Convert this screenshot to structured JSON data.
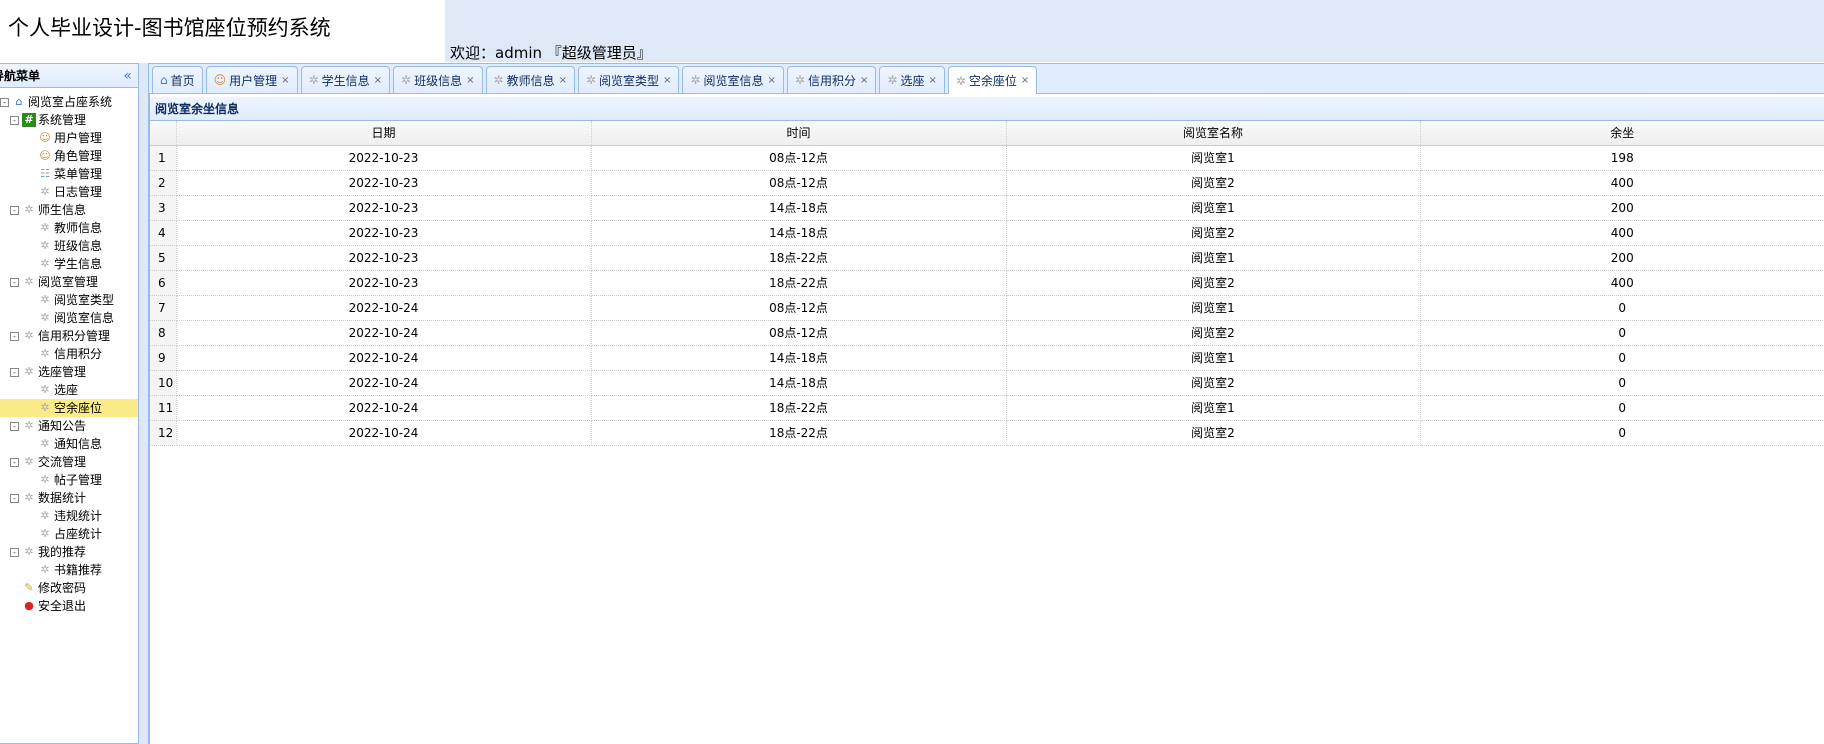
{
  "header": {
    "title": "个人毕业设计-图书馆座位预约系统",
    "welcome": "欢迎：admin 『超级管理员』"
  },
  "sidebar": {
    "title": "导航菜单",
    "collapse": "«",
    "items": [
      {
        "label": "阅览室占座系统",
        "level": 0,
        "icon": "home-icon",
        "toggle": "⊟"
      },
      {
        "label": "系统管理",
        "level": 1,
        "icon": "hash-icon",
        "toggle": "⊟"
      },
      {
        "label": "用户管理",
        "level": 2,
        "icon": "user-icon"
      },
      {
        "label": "角色管理",
        "level": 2,
        "icon": "users-icon"
      },
      {
        "label": "菜单管理",
        "level": 2,
        "icon": "sitemap-icon"
      },
      {
        "label": "日志管理",
        "level": 2,
        "icon": "gear-icon"
      },
      {
        "label": "师生信息",
        "level": 1,
        "icon": "gear-icon",
        "toggle": "⊟"
      },
      {
        "label": "教师信息",
        "level": 2,
        "icon": "gear-icon"
      },
      {
        "label": "班级信息",
        "level": 2,
        "icon": "gear-icon"
      },
      {
        "label": "学生信息",
        "level": 2,
        "icon": "gear-icon"
      },
      {
        "label": "阅览室管理",
        "level": 1,
        "icon": "gear-icon",
        "toggle": "⊟"
      },
      {
        "label": "阅览室类型",
        "level": 2,
        "icon": "gear-icon"
      },
      {
        "label": "阅览室信息",
        "level": 2,
        "icon": "gear-icon"
      },
      {
        "label": "信用积分管理",
        "level": 1,
        "icon": "gear-icon",
        "toggle": "⊟"
      },
      {
        "label": "信用积分",
        "level": 2,
        "icon": "gear-icon"
      },
      {
        "label": "选座管理",
        "level": 1,
        "icon": "gear-icon",
        "toggle": "⊟"
      },
      {
        "label": "选座",
        "level": 2,
        "icon": "gear-icon"
      },
      {
        "label": "空余座位",
        "level": 2,
        "icon": "gear-icon",
        "selected": true
      },
      {
        "label": "通知公告",
        "level": 1,
        "icon": "gear-icon",
        "toggle": "⊟"
      },
      {
        "label": "通知信息",
        "level": 2,
        "icon": "gear-icon"
      },
      {
        "label": "交流管理",
        "level": 1,
        "icon": "gear-icon",
        "toggle": "⊟"
      },
      {
        "label": "帖子管理",
        "level": 2,
        "icon": "gear-icon"
      },
      {
        "label": "数据统计",
        "level": 1,
        "icon": "gear-icon",
        "toggle": "⊟"
      },
      {
        "label": "违规统计",
        "level": 2,
        "icon": "gear-icon"
      },
      {
        "label": "占座统计",
        "level": 2,
        "icon": "gear-icon"
      },
      {
        "label": "我的推荐",
        "level": 1,
        "icon": "gear-icon",
        "toggle": "⊟"
      },
      {
        "label": "书籍推荐",
        "level": 2,
        "icon": "gear-icon"
      },
      {
        "label": "修改密码",
        "level": 1,
        "icon": "key-icon"
      },
      {
        "label": "安全退出",
        "level": 1,
        "icon": "exit-icon"
      }
    ]
  },
  "tabs": [
    {
      "label": "首页",
      "closable": false,
      "icon": "home-icon"
    },
    {
      "label": "用户管理",
      "closable": true,
      "icon": "user-icon"
    },
    {
      "label": "学生信息",
      "closable": true,
      "icon": "gear-icon"
    },
    {
      "label": "班级信息",
      "closable": true,
      "icon": "gear-icon"
    },
    {
      "label": "教师信息",
      "closable": true,
      "icon": "gear-icon"
    },
    {
      "label": "阅览室类型",
      "closable": true,
      "icon": "gear-icon"
    },
    {
      "label": "阅览室信息",
      "closable": true,
      "icon": "gear-icon"
    },
    {
      "label": "信用积分",
      "closable": true,
      "icon": "gear-icon"
    },
    {
      "label": "选座",
      "closable": true,
      "icon": "gear-icon"
    },
    {
      "label": "空余座位",
      "closable": true,
      "icon": "gear-icon",
      "active": true
    }
  ],
  "panel": {
    "title": "阅览室余坐信息",
    "columns": [
      "日期",
      "时间",
      "阅览室名称",
      "余坐"
    ],
    "rows": [
      [
        "1",
        "2022-10-23",
        "08点-12点",
        "阅览室1",
        "198"
      ],
      [
        "2",
        "2022-10-23",
        "08点-12点",
        "阅览室2",
        "400"
      ],
      [
        "3",
        "2022-10-23",
        "14点-18点",
        "阅览室1",
        "200"
      ],
      [
        "4",
        "2022-10-23",
        "14点-18点",
        "阅览室2",
        "400"
      ],
      [
        "5",
        "2022-10-23",
        "18点-22点",
        "阅览室1",
        "200"
      ],
      [
        "6",
        "2022-10-23",
        "18点-22点",
        "阅览室2",
        "400"
      ],
      [
        "7",
        "2022-10-24",
        "08点-12点",
        "阅览室1",
        "0"
      ],
      [
        "8",
        "2022-10-24",
        "08点-12点",
        "阅览室2",
        "0"
      ],
      [
        "9",
        "2022-10-24",
        "14点-18点",
        "阅览室1",
        "0"
      ],
      [
        "10",
        "2022-10-24",
        "14点-18点",
        "阅览室2",
        "0"
      ],
      [
        "11",
        "2022-10-24",
        "18点-22点",
        "阅览室1",
        "0"
      ],
      [
        "12",
        "2022-10-24",
        "18点-22点",
        "阅览室2",
        "0"
      ]
    ]
  }
}
